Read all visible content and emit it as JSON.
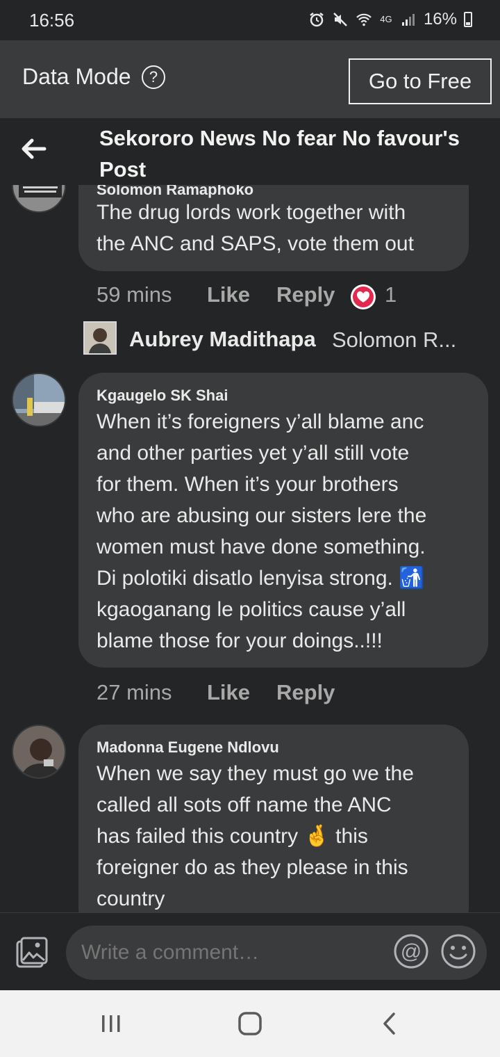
{
  "status_bar": {
    "time": "16:56",
    "network": "4G",
    "battery": "16%"
  },
  "data_mode": {
    "label": "Data Mode",
    "help_icon": "question-circle-icon",
    "button": "Go to Free"
  },
  "header": {
    "back_icon": "arrow-left-icon",
    "title": "Sekororo News No fear No favour's Post"
  },
  "comments": [
    {
      "author": "Solomon Ramaphoko",
      "text": "The drug lords work together with\nthe ANC and SAPS, vote them out",
      "time": "59 mins",
      "like": "Like",
      "reply": "Reply",
      "reaction_icon": "love-reaction-icon",
      "reaction_count": "1",
      "reply_preview": {
        "name": "Aubrey Madithapa",
        "snippet": "Solomon R..."
      }
    },
    {
      "author": "Kgaugelo SK Shai",
      "text": "When it’s foreigners y’all blame anc\nand other parties yet y’all still vote\nfor them. When it’s your brothers\nwho are abusing our sisters lere the\nwomen must have done something.\nDi polotiki disatlo lenyisa strong. 🚮\nkgaoganang le politics cause y’all\nblame those for your doings..!!!",
      "time": "27 mins",
      "like": "Like",
      "reply": "Reply"
    },
    {
      "author": "Madonna Eugene Ndlovu",
      "text": "When we say they must go we the\ncalled all sots off name the ANC\nhas failed this country 🤞 this\nforeigner do as they please in this\ncountry"
    }
  ],
  "composer": {
    "placeholder": "Write a comment…",
    "photo_icon": "photo-icon",
    "mention_icon": "at-sign-icon",
    "emoji_icon": "smiley-icon"
  },
  "nav": {
    "recents_icon": "recents-icon",
    "home_icon": "home-icon",
    "back_icon": "back-chevron-icon"
  },
  "colors": {
    "background": "#242526",
    "bubble": "#3a3b3c",
    "text": "#eaeaea",
    "meta": "#a8a8a8",
    "reaction": "#e2294f"
  }
}
